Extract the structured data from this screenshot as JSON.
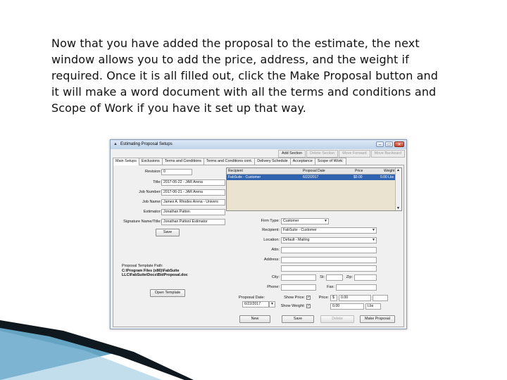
{
  "slide": {
    "paragraph": [
      "Now that you have added the proposal to the estimate, the next",
      "window allows you to add the price, address, and the weight if",
      "required. Once it is all filled out, click the Make Proposal button and",
      "it will make a word document with all the terms and conditions and",
      "Scope of Work if you have it set up that way."
    ]
  },
  "window": {
    "title": "Estimating Proposal Setups",
    "minimize": "–",
    "maximize": "□",
    "close": "✕"
  },
  "section_buttons": {
    "add": "Add Section",
    "delete": "Delete Section",
    "move_forward": "Move Forward",
    "move_backward": "Move Backward"
  },
  "tabs": [
    "Main Setups",
    "Exclusions",
    "Terms and Conditions",
    "Terms and Conditions cont.",
    "Delivery Schedule",
    "Acceptance",
    "Scope of Work:"
  ],
  "setup": {
    "revision_label": "Revision:",
    "revision": "0",
    "title_label": "Title:",
    "title": "2017-06-22 - JAR Arena",
    "job_number_label": "Job Number:",
    "job_number": "2017-06-21 - JAR Arena",
    "job_name_label": "Job Name:",
    "job_name": "James A. Rhodes Arena - Univers",
    "estimator_label": "Estimator:",
    "estimator": "Jonathan Patton",
    "signature_label": "Signature Name/Title:",
    "signature": "Jonathan Patton/ Estimator",
    "save_label": "Save"
  },
  "grid": {
    "headers": [
      "Recipient",
      "Proposal Date",
      "Price",
      "Weight"
    ],
    "rows": [
      [
        "FabSuite - Customer",
        "6/22/2017",
        "$0.00",
        "0.00 Lbs"
      ]
    ]
  },
  "firm": {
    "firm_type_label": "Firm Type:",
    "firm_type": "Customer",
    "recipient_label": "Recipient:",
    "recipient": "FabSuite - Customer",
    "location_label": "Location:",
    "location": "Default - Mailing",
    "attn_label": "Attn:",
    "attn": "",
    "address_label": "Address:",
    "address1": "",
    "address2": "",
    "city_label": "City:",
    "city": "",
    "st_label": "St:",
    "st": "",
    "zip_label": "Zip:",
    "zip": "",
    "phone_label": "Phone:",
    "phone": "",
    "fax_label": "Fax:",
    "fax": ""
  },
  "template": {
    "path_label": "Proposal Template Path:",
    "path_line1": "C:\\Program Files (x86)\\FabSuite",
    "path_line2": "LLC\\FabSuite\\Docs\\BidProposal.doc",
    "open_label": "Open Template"
  },
  "proposal": {
    "date_label": "Proposal Date:",
    "date": "6/22/2017",
    "show_price_label": "Show Price:",
    "show_price_checked": "✓",
    "price_label": "Price:",
    "price_currency": "$",
    "price": "0.00",
    "show_weight_label": "Show Weight:",
    "show_weight_checked": "✓",
    "weight": "0.00",
    "weight_unit": "Lbs"
  },
  "bottom_buttons": {
    "new": "New",
    "save": "Save",
    "delete": "Delete",
    "make_proposal": "Make Proposal"
  },
  "colors": {
    "selected_row": "#2f63b0",
    "grid_bg": "#eae3cf",
    "deco_dark": "#10181f",
    "deco_teal": "#4a93b8"
  }
}
